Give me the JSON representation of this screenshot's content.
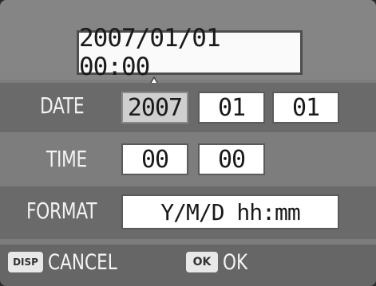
{
  "preview": {
    "text": "2007/01/01 00:00"
  },
  "date": {
    "label": "DATE",
    "year": "2007",
    "month": "01",
    "day": "01"
  },
  "time": {
    "label": "TIME",
    "hour": "00",
    "minute": "00"
  },
  "format": {
    "label": "FORMAT",
    "value": "Y/M/D hh:mm"
  },
  "footer": {
    "disp_key": "DISP",
    "cancel_label": "CANCEL",
    "ok_key": "OK",
    "ok_label": "OK"
  },
  "colors": {
    "background": "#7d7d7d",
    "field": "#ffffff",
    "selected_field": "#cfcfcf",
    "text_light": "#f2f2f2"
  },
  "icons": {
    "caret": "triangle-up-icon",
    "disp": "disp-button-icon",
    "ok": "ok-button-icon"
  }
}
